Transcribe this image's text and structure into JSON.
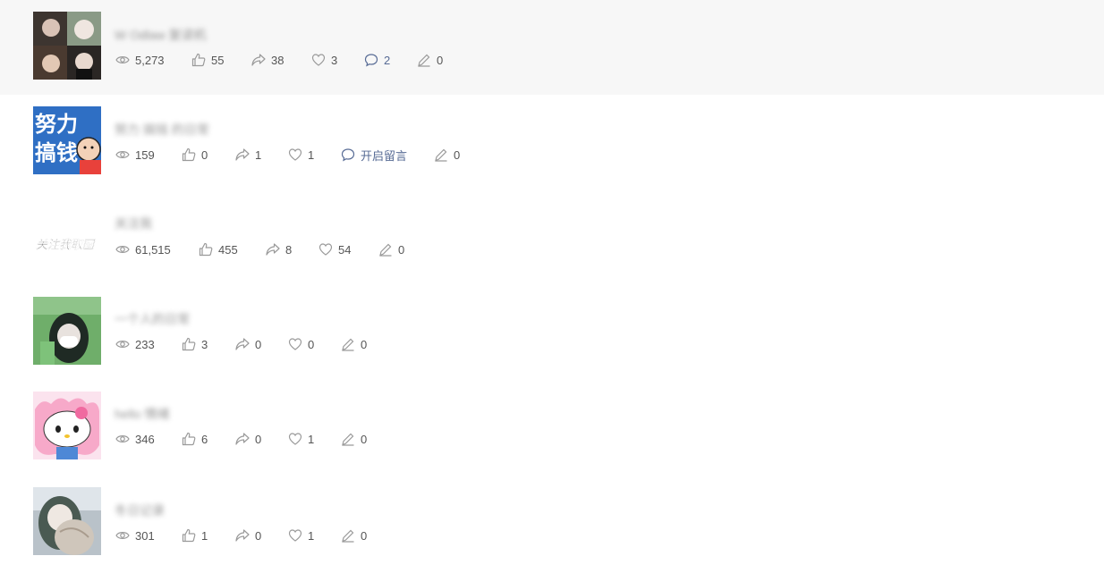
{
  "articles": [
    {
      "title": "W Odlaw 复读机",
      "views": "5,273",
      "likes": "55",
      "shares": "38",
      "favorites": "3",
      "comments": "2",
      "edits": "0",
      "comment_style": "count"
    },
    {
      "title": "努力 搞钱 的日常",
      "views": "159",
      "likes": "0",
      "shares": "1",
      "favorites": "1",
      "comments": "开启留言",
      "edits": "0",
      "comment_style": "open"
    },
    {
      "title": "关注我",
      "views": "61,515",
      "likes": "455",
      "shares": "8",
      "favorites": "54",
      "comments": "",
      "edits": "0",
      "comment_style": "none"
    },
    {
      "title": "一个人的日常",
      "views": "233",
      "likes": "3",
      "shares": "0",
      "favorites": "0",
      "comments": "",
      "edits": "0",
      "comment_style": "none"
    },
    {
      "title": "hello 情绪",
      "views": "346",
      "likes": "6",
      "shares": "0",
      "favorites": "1",
      "comments": "",
      "edits": "0",
      "comment_style": "none"
    },
    {
      "title": "冬日记录",
      "views": "301",
      "likes": "1",
      "shares": "0",
      "favorites": "1",
      "comments": "",
      "edits": "0",
      "comment_style": "none"
    }
  ],
  "thumbnail_texts": {
    "row2_line1": "努力",
    "row2_line2": "搞钱",
    "row3": "关注我取图"
  },
  "colors": {
    "highlight_bg": "#f7f7f7",
    "comment_accent": "#576b95",
    "icon_gray": "#9a9a9a",
    "text": "#555555"
  },
  "icons": [
    "eye-icon",
    "thumbs-up-icon",
    "share-icon",
    "heart-icon",
    "comment-icon",
    "pencil-icon"
  ]
}
